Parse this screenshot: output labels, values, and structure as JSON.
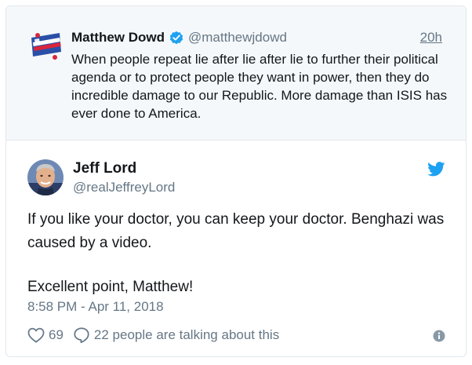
{
  "quoted_tweet": {
    "name": "Matthew Dowd",
    "handle": "@matthewjdowd",
    "time": "20h",
    "text": "When people repeat lie after lie after lie to further their political agenda or to protect people they want in power, then they do incredible damage to our Republic.  More damage than ISIS has ever done to America.",
    "avatar_icon": "flag-banner-avatar"
  },
  "tweet": {
    "name": "Jeff Lord",
    "handle": "@realJeffreyLord",
    "paragraphs": [
      "If you like your doctor, you can keep your doctor. Benghazi was caused by a video.",
      "Excellent point, Matthew!"
    ],
    "timestamp": "8:58 PM - Apr 11, 2018"
  },
  "actions": {
    "likes": "69",
    "conversation": "22 people are talking about this"
  },
  "colors": {
    "brand_blue": "#1da1f2",
    "secondary_text": "#657786",
    "primary_text": "#14171a",
    "quoted_bg": "#f5f8fa",
    "border": "#e1e8ed"
  }
}
